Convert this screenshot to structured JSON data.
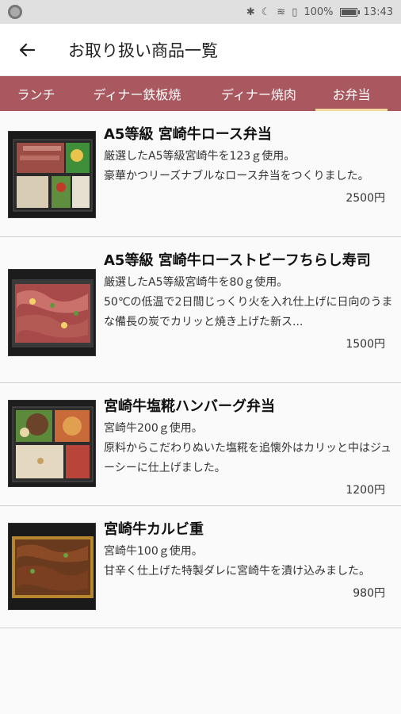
{
  "status_bar": {
    "battery": "100%",
    "time": "13:43",
    "battery_level": 1.0
  },
  "header": {
    "title": "お取り扱い商品一覧"
  },
  "tabs": [
    {
      "label": "ランチ"
    },
    {
      "label": "ディナー鉄板焼"
    },
    {
      "label": "ディナー焼肉"
    },
    {
      "label": "お弁当"
    }
  ],
  "active_tab": "お弁当",
  "items": [
    {
      "name": "A5等級 宮崎牛ロース弁当",
      "desc": "厳選したA5等級宮崎牛を123ｇ使用。\n豪華かつリーズナブルなロース弁当をつくりました。",
      "price": "2500円"
    },
    {
      "name": "A5等級 宮崎牛ローストビーフちらし寿司",
      "desc": "厳選したA5等級宮崎牛を80ｇ使用。\n50℃の低温で2日間じっくり火を入れ仕上げに日向のうまな備長の炭でカリッと焼き上げた新ス...",
      "price": "1500円"
    },
    {
      "name": "宮崎牛塩糀ハンバーグ弁当",
      "desc": "宮崎牛200ｇ使用。\n原料からこだわりぬいた塩糀を追懐外はカリッと中はジューシーに仕上げました。",
      "price": "1200円"
    },
    {
      "name": "宮崎牛カルビ重",
      "desc": "宮崎牛100ｇ使用。\n甘辛く仕上げた特製ダレに宮崎牛を漬け込みました。",
      "price": "980円"
    }
  ]
}
